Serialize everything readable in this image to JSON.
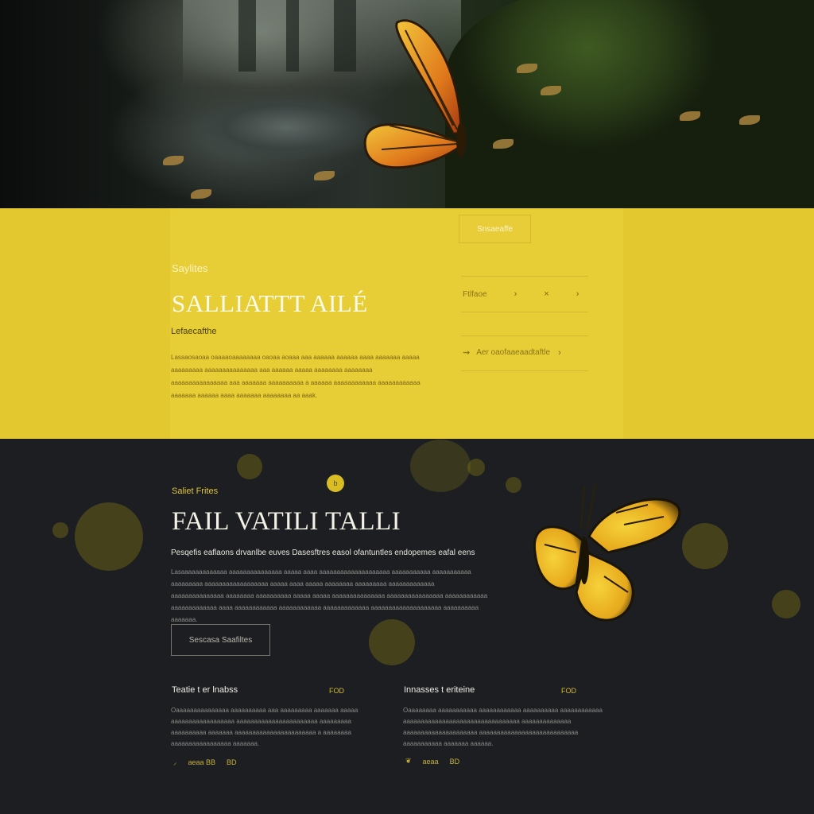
{
  "band": {
    "eyebrow": "Saylites",
    "title": "SALLIATTT AILÉ",
    "subtitle": "Lefaecafthe",
    "paragraph": "Lasaaosaoaa oaaaaoaaaaaaaa oaoaa aoaaa aaa aaaaaa aaaaaa aaaa aaaaaaa aaaaa aaaaaaaaa aaaaaaaaaaaaaaa aaa aaaaaa aaaaa aaaaaaaa aaaaaaaa aaaaaaaaaaaaaaaa aaa aaaaaaa aaaaaaaaaa a aaaaaa aaaaaaaaaaaa aaaaaaaaaaaa aaaaaaa aaaaaa aaaa aaaaaaa aaaaaaaa aa aaak.",
    "pill": "Snsaeaffe",
    "menu_row_1": "Ftlfaoe",
    "menu_row_2": "Aer oaofaaeaadtaftle"
  },
  "section": {
    "eyebrow": "Saliet Frites",
    "title": "FAIL VATILI TALLI",
    "subtitle": "Pesqefis eaflaons drvanlbe euves Dasesftres easol ofantuntles endopemes eafal eens",
    "paragraph": "Lasaaaaaaaaaaaaa aaaaaaaaaaaaaaa aaaaa aaaa aaaaaaaaaaaaaaaaaaaa aaaaaaaaaaa aaaaaaaaaaa aaaaaaaaa aaaaaaaaaaaaaaaaaa aaaaa aaaa aaaaa aaaaaaaa aaaaaaaaa aaaaaaaaaaaaa aaaaaaaaaaaaaaa aaaaaaaa aaaaaaaaaa aaaaa aaaaa aaaaaaaaaaaaaaa aaaaaaaaaaaaaaaa aaaaaaaaaaaa aaaaaaaaaaaaa aaaa aaaaaaaaaaaa aaaaaaaaaaaa aaaaaaaaaaaaa aaaaaaaaaaaaaaaaaaaa aaaaaaaaaa aaaaaaa.",
    "button": "Sescasa Saafiltes",
    "dot": "b"
  },
  "columns": [
    {
      "title": "Teatie t er lnabss",
      "tag": "FOD",
      "text": "Oaaaaaaaaaaaaaaa aaaaaaaaaa aaa aaaaaaaaa aaaaaaa aaaaa aaaaaaaaaaaaaaaaaa aaaaaaaaaaaaaaaaaaaaaaa aaaaaaaaa aaaaaaaaaa aaaaaaa aaaaaaaaaaaaaaaaaaaaaaa a aaaaaaaa aaaaaaaaaaaaaaaaa aaaaaaa.",
      "meta_a": "aeaa BB",
      "meta_b": "BD"
    },
    {
      "title": "Innasses t eriteine",
      "tag": "FOD",
      "text": "Oaaaaaaaa aaaaaaaaaaa aaaaaaaaaaaa aaaaaaaaaa aaaaaaaaaaaa aaaaaaaaaaaaaaaaaaaaaaaaaaaaaaaaa aaaaaaaaaaaaaa aaaaaaaaaaaaaaaaaaaaa aaaaaaaaaaaaaaaaaaaaaaaaaaaa aaaaaaaaaaa aaaaaaa aaaaaa.",
      "meta_a": "aeaa",
      "meta_b": "BD"
    }
  ]
}
